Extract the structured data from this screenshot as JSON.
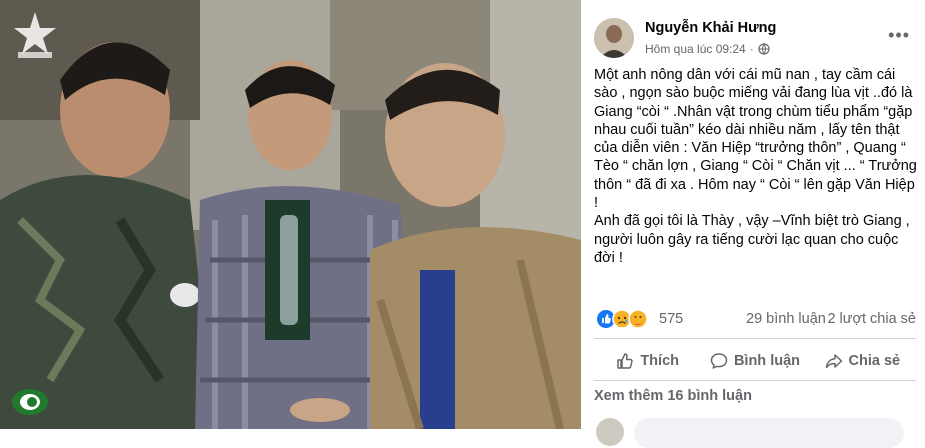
{
  "post": {
    "author": "Nguyễn Khải Hưng",
    "timestamp": "Hôm qua lúc 09:24",
    "privacy_icon": "globe-icon",
    "more_label": "•••",
    "body": [
      "Một anh nông dân với cái mũ nan , tay cầm cái sào , ngọn sào buộc miếng vải đang lùa vịt ..đó là Giang “còi “ .Nhân vật trong chùm tiểu phẩm “gặp nhau cuối tuần” kéo dài nhiều năm , lấy tên thật của diễn viên : Văn Hiệp “trưởng thôn” , Quang “ Tèo “ chăn lợn , Giang “ Còi “ Chăn vịt ... “ Trưởng thôn “ đã đi xa . Hôm nay “ Còi “ lên gặp Văn Hiệp !",
      "Anh đã gọi tôi là Thày , vậy –Vĩnh biệt trò Giang , người luôn gây ra tiếng cười lạc quan cho cuộc đời !"
    ],
    "reactions": {
      "icons": [
        "like-icon",
        "sad-icon",
        "care-icon"
      ],
      "count": "575"
    },
    "comments_count": "29 bình luận",
    "shares_count": "2 lượt chia sẻ",
    "actions": {
      "like": "Thích",
      "comment": "Bình luận",
      "share": "Chia sẻ"
    },
    "see_more_comments": "Xem thêm 16 bình luận"
  },
  "colors": {
    "text_primary": "#050505",
    "text_secondary": "#65676b",
    "like_blue": "#1877f2",
    "divider": "#ced0d4",
    "input_bg": "#f0f2f5"
  }
}
